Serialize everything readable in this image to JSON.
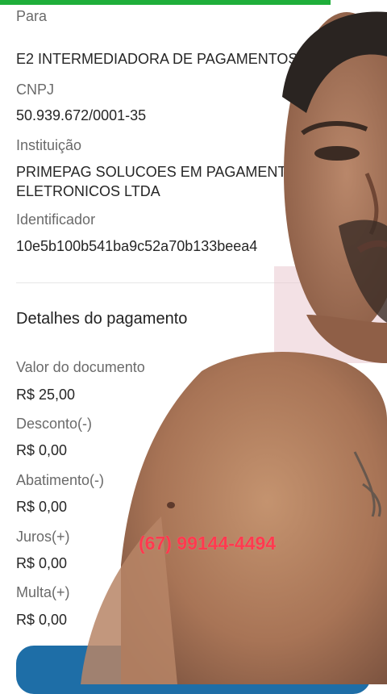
{
  "recipient": {
    "section_label": "Para",
    "name": "E2 INTERMEDIADORA DE PAGAMENTOS",
    "cnpj_label": "CNPJ",
    "cnpj": "50.939.672/0001-35",
    "institution_label": "Instituição",
    "institution_line1": "PRIMEPAG SOLUCOES EM PAGAMENTOS",
    "institution_line2": "ELETRONICOS LTDA",
    "identifier_label": "Identificador",
    "identifier": "10e5b100b541ba9c52a70b133beea4"
  },
  "payment_details": {
    "title": "Detalhes do pagamento",
    "items": [
      {
        "label": "Valor do documento",
        "value": "R$ 25,00"
      },
      {
        "label": "Desconto(-)",
        "value": "R$ 0,00"
      },
      {
        "label": "Abatimento(-)",
        "value": "R$ 0,00"
      },
      {
        "label": "Juros(+)",
        "value": "R$ 0,00"
      },
      {
        "label": "Multa(+)",
        "value": "R$ 0,00"
      }
    ]
  },
  "overlay": {
    "phone": "(67) 99144-4494"
  },
  "colors": {
    "accent_green": "#1fae3a",
    "button_blue": "#1e6ea7",
    "overlay_red": "#ff3a4f"
  }
}
